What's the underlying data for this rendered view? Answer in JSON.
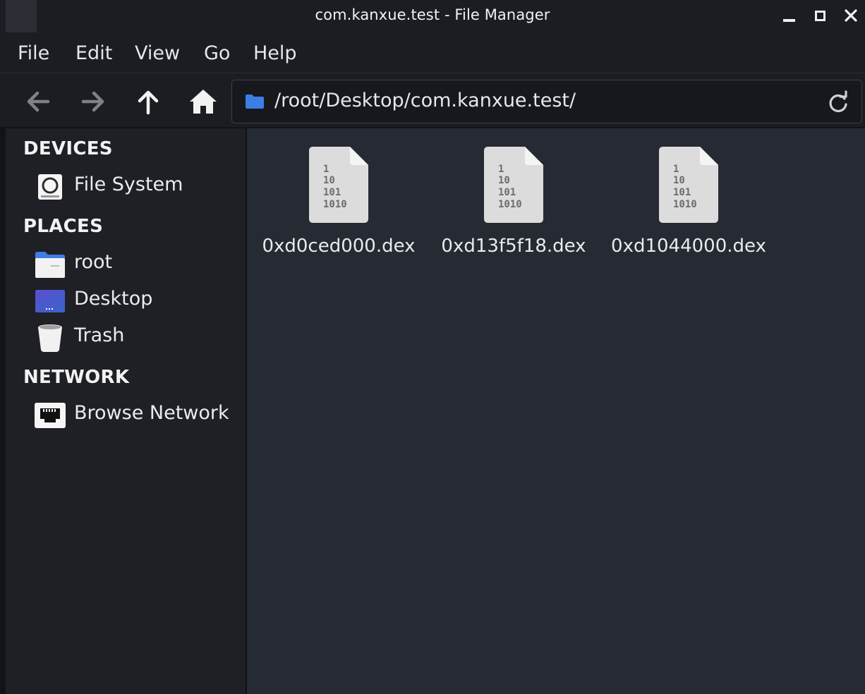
{
  "window": {
    "title": "com.kanxue.test - File Manager"
  },
  "menubar": {
    "file": "File",
    "edit": "Edit",
    "view": "View",
    "go": "Go",
    "help": "Help"
  },
  "toolbar": {
    "location": "/root/Desktop/com.kanxue.test/"
  },
  "sidebar": {
    "devices_heading": "DEVICES",
    "places_heading": "PLACES",
    "network_heading": "NETWORK",
    "devices": [
      {
        "label": "File System",
        "icon": "drive-icon"
      }
    ],
    "places": [
      {
        "label": "root",
        "icon": "home-folder-icon"
      },
      {
        "label": "Desktop",
        "icon": "desktop-icon"
      },
      {
        "label": "Trash",
        "icon": "trash-icon"
      }
    ],
    "network": [
      {
        "label": "Browse Network",
        "icon": "network-icon"
      }
    ]
  },
  "files": [
    {
      "name": "0xd0ced000.dex",
      "icon": "binary-file-icon",
      "icon_lines": [
        "1",
        "10",
        "101",
        "1010"
      ]
    },
    {
      "name": "0xd13f5f18.dex",
      "icon": "binary-file-icon",
      "icon_lines": [
        "1",
        "10",
        "101",
        "1010"
      ]
    },
    {
      "name": "0xd1044000.dex",
      "icon": "binary-file-icon",
      "icon_lines": [
        "1",
        "10",
        "101",
        "1010"
      ]
    }
  ],
  "colors": {
    "background": "#262a33",
    "sidebar": "#1e2026",
    "chrome": "#1b1d23",
    "accent_folder": "#3d7ee6"
  }
}
